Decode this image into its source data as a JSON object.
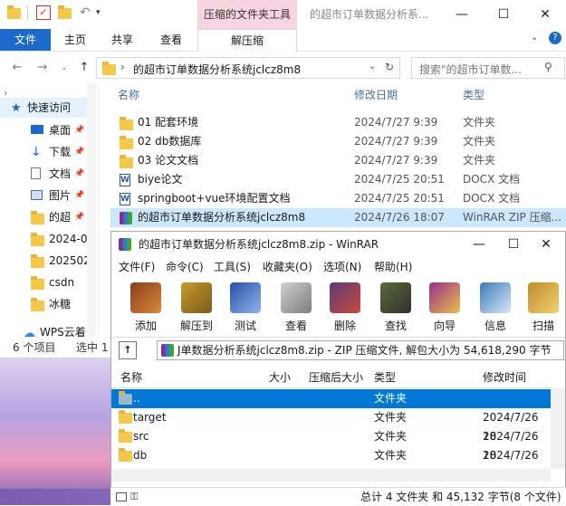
{
  "explorer": {
    "context_tab": "压缩的文件夹工具",
    "window_title": "的超市订单数据分析系...",
    "ribbon_tabs": [
      "文件",
      "主页",
      "共享",
      "查看",
      "解压缩"
    ],
    "address": "的超市订单数据分析系统jclcz8m8",
    "search_placeholder": "搜索\"的超市订单数...",
    "columns": {
      "name": "名称",
      "date": "修改日期",
      "type": "类型"
    },
    "nav": [
      {
        "label": "快速访问",
        "icon": "star-icon"
      },
      {
        "label": "桌面",
        "icon": "desktop-icon"
      },
      {
        "label": "下载",
        "icon": "download-icon"
      },
      {
        "label": "文档",
        "icon": "document-icon"
      },
      {
        "label": "图片",
        "icon": "picture-icon"
      },
      {
        "label": "的超",
        "icon": "folder-icon"
      },
      {
        "label": "2024-0",
        "icon": "folder-icon"
      },
      {
        "label": "202502",
        "icon": "folder-icon"
      },
      {
        "label": "csdn",
        "icon": "folder-icon"
      },
      {
        "label": "冰糖",
        "icon": "folder-icon"
      },
      {
        "label": "WPS云着",
        "icon": "cloud-icon"
      }
    ],
    "files": [
      {
        "name": "01 配套环境",
        "date": "2024/7/27 9:39",
        "type": "文件夹",
        "icon": "folder-icon"
      },
      {
        "name": "02 db数据库",
        "date": "2024/7/27 9:39",
        "type": "文件夹",
        "icon": "folder-icon"
      },
      {
        "name": "03 论文文档",
        "date": "2024/7/27 9:39",
        "type": "文件夹",
        "icon": "folder-icon"
      },
      {
        "name": "biye论文",
        "date": "2024/7/25 20:51",
        "type": "DOCX 文档",
        "icon": "word-icon"
      },
      {
        "name": "springboot+vue环境配置文档",
        "date": "2024/7/25 20:51",
        "type": "DOCX 文档",
        "icon": "word-icon"
      },
      {
        "name": "的超市订单数据分析系统jclcz8m8",
        "date": "2024/7/26 18:07",
        "type": "WinRAR ZIP 压缩...",
        "icon": "rar-icon"
      }
    ],
    "status_count": "6 个项目",
    "status_selected": "选中 1"
  },
  "winrar": {
    "title": "的超市订单数据分析系统jclcz8m8.zip - WinRAR",
    "menu": [
      "文件(F)",
      "命令(C)",
      "工具(S)",
      "收藏夹(O)",
      "选项(N)",
      "帮助(H)"
    ],
    "tools": [
      {
        "label": "添加",
        "icon": "add-archive-icon",
        "color": "#8a3b1e"
      },
      {
        "label": "解压到",
        "icon": "extract-icon",
        "color": "#c79b2c"
      },
      {
        "label": "测试",
        "icon": "test-icon",
        "color": "#2a4fa8"
      },
      {
        "label": "查看",
        "icon": "view-icon",
        "color": "#7d7d7d"
      },
      {
        "label": "删除",
        "icon": "delete-icon",
        "color": "#5b3a7a"
      },
      {
        "label": "查找",
        "icon": "find-icon",
        "color": "#5a6b3a"
      },
      {
        "label": "向导",
        "icon": "wizard-icon",
        "color": "#9a2e8c"
      },
      {
        "label": "信息",
        "icon": "info-icon",
        "color": "#3a7ab8"
      },
      {
        "label": "扫描",
        "icon": "scan-icon",
        "color": "#c28a2a"
      }
    ],
    "path": "J单数据分析系统jclcz8m8.zip - ZIP 压缩文件, 解包大小为 54,618,290 字节",
    "columns": {
      "name": "名称",
      "size": "大小",
      "packed": "压缩后大小",
      "type": "类型",
      "modified": "修改时间"
    },
    "rows": [
      {
        "name": "..",
        "type": "文件夹",
        "modified": ""
      },
      {
        "name": "target",
        "type": "文件夹",
        "modified": "2024/7/26 18"
      },
      {
        "name": "src",
        "type": "文件夹",
        "modified": "2024/7/26 18"
      },
      {
        "name": "db",
        "type": "文件夹",
        "modified": "2024/7/26 18"
      }
    ],
    "status": "总计 4 文件夹 和 45,132 字节(8 个文件)"
  }
}
